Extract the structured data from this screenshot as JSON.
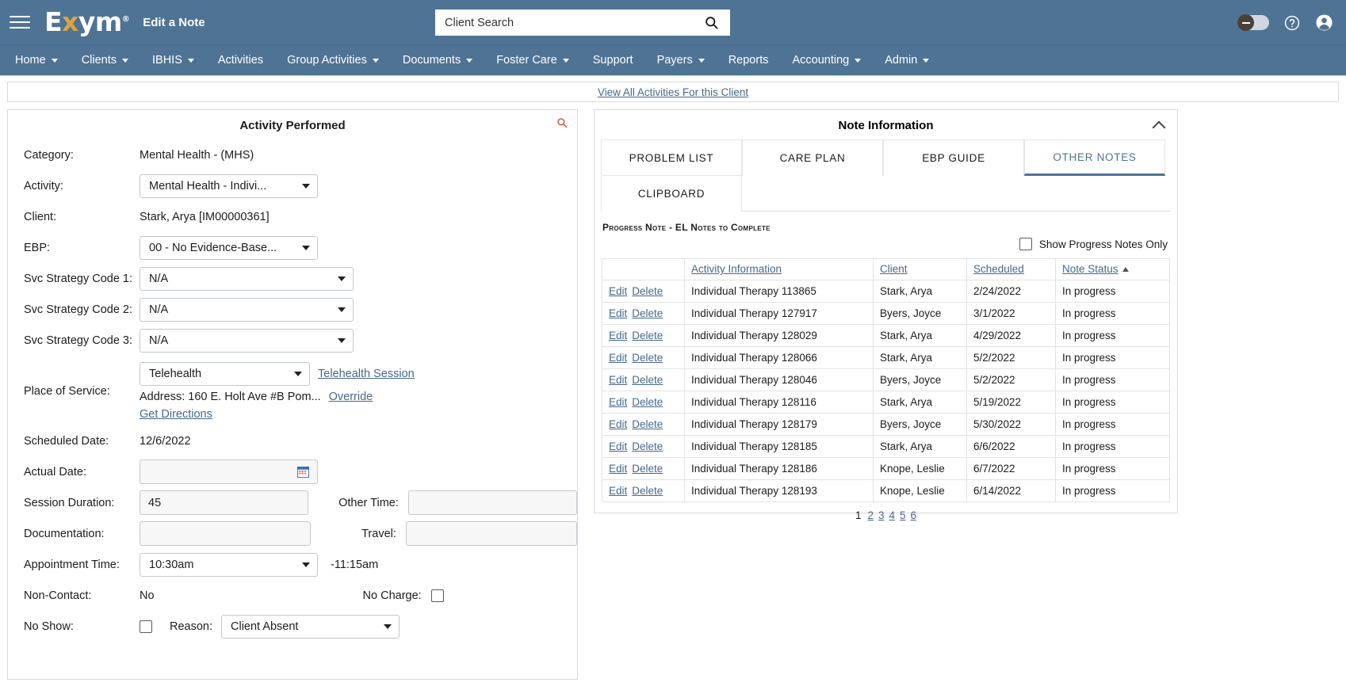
{
  "header": {
    "brand_prefix": "E",
    "brand_x": "x",
    "brand_suffix": "ym",
    "brand_reg": "®",
    "page_title": "Edit a Note",
    "accent_color": "#4f7395",
    "logo_accent_color": "#d9a441",
    "link_color": "#46688c"
  },
  "search": {
    "placeholder": "Client Search",
    "value": ""
  },
  "nav": {
    "items": [
      {
        "label": "Home",
        "has_caret": true
      },
      {
        "label": "Clients",
        "has_caret": true
      },
      {
        "label": "IBHIS",
        "has_caret": true
      },
      {
        "label": "Activities",
        "has_caret": false
      },
      {
        "label": "Group Activities",
        "has_caret": true
      },
      {
        "label": "Documents",
        "has_caret": true
      },
      {
        "label": "Foster Care",
        "has_caret": true
      },
      {
        "label": "Support",
        "has_caret": false
      },
      {
        "label": "Payers",
        "has_caret": true
      },
      {
        "label": "Reports",
        "has_caret": false
      },
      {
        "label": "Accounting",
        "has_caret": true
      },
      {
        "label": "Admin",
        "has_caret": true
      }
    ]
  },
  "viewall": {
    "label": "View All Activities For this Client"
  },
  "activity_panel": {
    "title": "Activity Performed",
    "category_label": "Category:",
    "category_value": "Mental Health - (MHS)",
    "activity_label": "Activity:",
    "activity_value": "Mental Health - Indivi...",
    "client_label": "Client:",
    "client_value": "Stark, Arya [IM00000361]",
    "ebp_label": "EBP:",
    "ebp_value": "00 - No Evidence-Base...",
    "svc1_label": "Svc Strategy Code 1:",
    "svc1_value": "N/A",
    "svc2_label": "Svc Strategy Code 2:",
    "svc2_value": "N/A",
    "svc3_label": "Svc Strategy Code 3:",
    "svc3_value": "N/A",
    "pos_label": "Place of Service:",
    "pos_value": "Telehealth",
    "telehealth_link": "Telehealth Session",
    "address_text": "Address: 160 E. Holt Ave #B Pom...",
    "override_link": "Override",
    "directions_link": "Get Directions",
    "sched_date_label": "Scheduled Date:",
    "sched_date_value": "12/6/2022",
    "actual_date_label": "Actual Date:",
    "actual_date_value": "",
    "session_duration_label": "Session Duration:",
    "session_duration_value": "45",
    "other_time_label": "Other Time:",
    "other_time_value": "",
    "documentation_label": "Documentation:",
    "documentation_value": "",
    "travel_label": "Travel:",
    "travel_value": "",
    "appt_time_label": "Appointment Time:",
    "appt_time_value": "10:30am",
    "appt_end_value": "-11:15am",
    "non_contact_label": "Non-Contact:",
    "non_contact_value": "No",
    "no_charge_label": "No Charge:",
    "no_charge_checked": false,
    "no_show_label": "No Show:",
    "no_show_checked": false,
    "reason_label": "Reason:",
    "reason_value": "Client Absent"
  },
  "note_panel": {
    "title": "Note Information",
    "tabs": [
      {
        "label": "PROBLEM LIST",
        "active": false
      },
      {
        "label": "CARE PLAN",
        "active": false
      },
      {
        "label": "EBP GUIDE",
        "active": false
      },
      {
        "label": "OTHER NOTES",
        "active": true
      },
      {
        "label": "CLIPBOARD",
        "active": false
      }
    ],
    "section_title": "Progress Note - EL Notes to Complete",
    "show_progress_label": "Show Progress Notes Only",
    "show_progress_checked": false,
    "columns": [
      "",
      "Activity Information",
      "Client",
      "Scheduled",
      "Note Status"
    ],
    "sort_column": "Note Status",
    "sort_direction": "asc",
    "edit_label": "Edit",
    "delete_label": "Delete",
    "rows": [
      {
        "activity": "Individual Therapy 113865",
        "client": "Stark, Arya",
        "scheduled": "2/24/2022",
        "status": "In progress"
      },
      {
        "activity": "Individual Therapy 127917",
        "client": "Byers, Joyce",
        "scheduled": "3/1/2022",
        "status": "In progress"
      },
      {
        "activity": "Individual Therapy 128029",
        "client": "Stark, Arya",
        "scheduled": "4/29/2022",
        "status": "In progress"
      },
      {
        "activity": "Individual Therapy 128066",
        "client": "Stark, Arya",
        "scheduled": "5/2/2022",
        "status": "In progress"
      },
      {
        "activity": "Individual Therapy 128046",
        "client": "Byers, Joyce",
        "scheduled": "5/2/2022",
        "status": "In progress"
      },
      {
        "activity": "Individual Therapy 128116",
        "client": "Stark, Arya",
        "scheduled": "5/19/2022",
        "status": "In progress"
      },
      {
        "activity": "Individual Therapy 128179",
        "client": "Byers, Joyce",
        "scheduled": "5/30/2022",
        "status": "In progress"
      },
      {
        "activity": "Individual Therapy 128185",
        "client": "Stark, Arya",
        "scheduled": "6/6/2022",
        "status": "In progress"
      },
      {
        "activity": "Individual Therapy 128186",
        "client": "Knope, Leslie",
        "scheduled": "6/7/2022",
        "status": "In progress"
      },
      {
        "activity": "Individual Therapy 128193",
        "client": "Knope, Leslie",
        "scheduled": "6/14/2022",
        "status": "In progress"
      }
    ],
    "pagination": {
      "current": "1",
      "pages": [
        "2",
        "3",
        "4",
        "5",
        "6"
      ]
    }
  }
}
